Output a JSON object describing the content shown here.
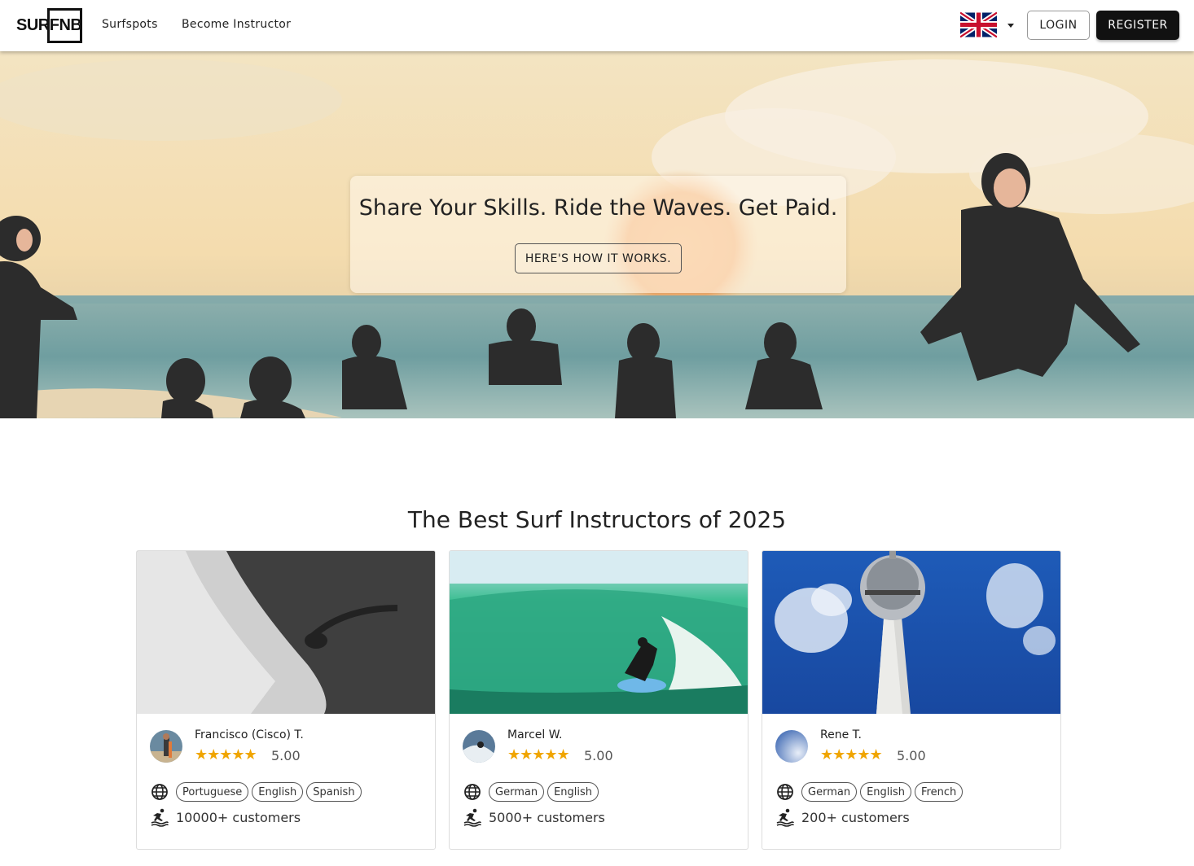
{
  "brand": {
    "logo": "SURFNB"
  },
  "nav": {
    "links": [
      "Surfspots",
      "Become Instructor"
    ],
    "language_icon": "uk-flag-icon",
    "login": "LOGIN",
    "register": "REGISTER"
  },
  "hero": {
    "headline": "Share Your Skills. Ride the Waves. Get Paid.",
    "cta": "HERE'S HOW IT WORKS."
  },
  "section": {
    "title": "The Best Surf Instructors of 2025"
  },
  "colors": {
    "star": "#f0a500",
    "primary_dark": "#111111"
  },
  "instructors": [
    {
      "name": "Francisco (Cisco) T.",
      "stars": "★★★★★",
      "rating": "5.00",
      "languages": [
        "Portuguese",
        "English",
        "Spanish"
      ],
      "customers": "10000+ customers"
    },
    {
      "name": "Marcel W.",
      "stars": "★★★★★",
      "rating": "5.00",
      "languages": [
        "German",
        "English"
      ],
      "customers": "5000+ customers"
    },
    {
      "name": "Rene T.",
      "stars": "★★★★★",
      "rating": "5.00",
      "languages": [
        "German",
        "English",
        "French"
      ],
      "customers": "200+ customers"
    }
  ]
}
